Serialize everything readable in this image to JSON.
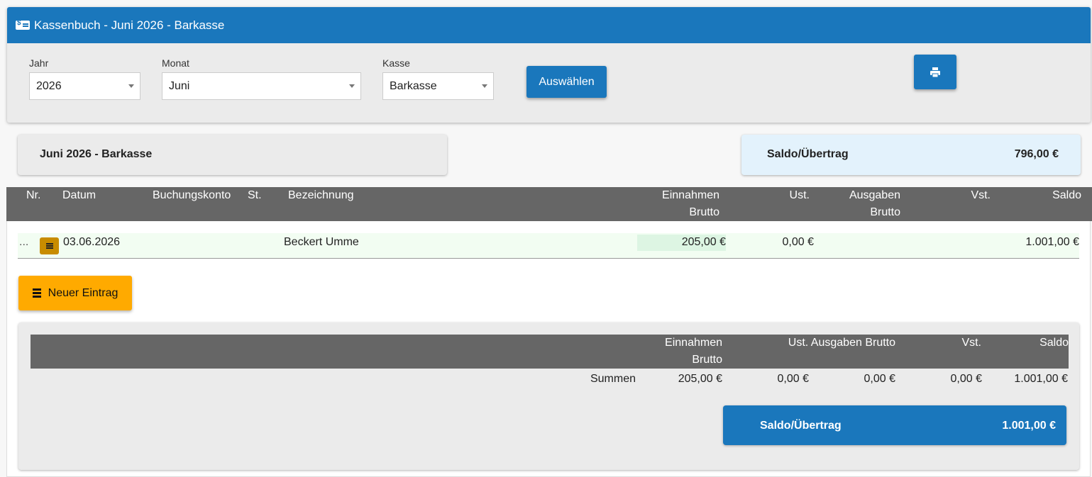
{
  "header": {
    "title": "Kassenbuch - Juni 2026 - Barkasse",
    "icon": "cash-register-icon"
  },
  "filters": {
    "year": {
      "label": "Jahr",
      "value": "2026"
    },
    "month": {
      "label": "Monat",
      "value": "Juni"
    },
    "register": {
      "label": "Kasse",
      "value": "Barkasse"
    },
    "select_button": "Auswählen",
    "print_icon": "print-icon"
  },
  "period_box": {
    "title": "Juni 2026 - Barkasse"
  },
  "opening_balance": {
    "label": "Saldo/Übertrag",
    "value": "796,00 €"
  },
  "table": {
    "columns": {
      "nr": "Nr.",
      "datum": "Datum",
      "buchungskonto": "Buchungskonto",
      "st": "St.",
      "bezeichnung": "Bezeichnung",
      "einnahmen_l1": "Einnahmen",
      "einnahmen_l2": "Brutto",
      "ust": "Ust.",
      "ausgaben_l1": "Ausgaben",
      "ausgaben_l2": "Brutto",
      "vst": "Vst.",
      "saldo": "Saldo"
    },
    "rows": [
      {
        "nr": "...",
        "datum": "03.06.2026",
        "bezeichnung": "Beckert Umme",
        "einnahmen": "205,00 €",
        "ust": "0,00 €",
        "saldo": "1.001,00 €"
      }
    ]
  },
  "new_entry_button": "Neuer Eintrag",
  "summary": {
    "columns": {
      "einnahmen_l1": "Einnahmen",
      "einnahmen_l2": "Brutto",
      "ust_ausgaben": "Ust. Ausgaben Brutto",
      "vst": "Vst.",
      "saldo": "Saldo"
    },
    "label": "Summen",
    "einnahmen": "205,00 €",
    "ust": "0,00 €",
    "ausgaben": "0,00 €",
    "vst": "0,00 €",
    "saldo": "1.001,00 €"
  },
  "closing_balance": {
    "label": "Saldo/Übertrag",
    "value": "1.001,00 €"
  },
  "colors": {
    "primary": "#1a77bc",
    "warning": "#ffaa00",
    "header_gray": "#666666",
    "row_bg": "#f2fdf2"
  }
}
